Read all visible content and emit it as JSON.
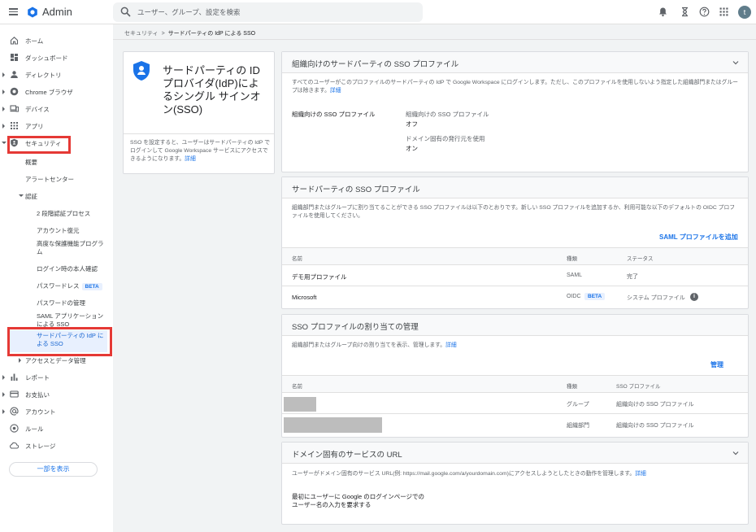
{
  "header": {
    "app_title": "Admin",
    "search_placeholder": "ユーザー、グループ、設定を検索",
    "avatar_letter": "t",
    "colors": {
      "logo": "#1a73e8",
      "accent": "#1a73e8",
      "highlight": "#e53935"
    },
    "icons": [
      "menu-icon",
      "admin-logo-icon",
      "search-icon",
      "notifications-icon",
      "hourglass-icon",
      "help-icon",
      "apps-grid-icon"
    ]
  },
  "sidebar": {
    "items": [
      {
        "label": "ホーム",
        "icon": "home-icon"
      },
      {
        "label": "ダッシュボード",
        "icon": "dashboard-icon"
      },
      {
        "label": "ディレクトリ",
        "icon": "person-icon"
      },
      {
        "label": "Chrome ブラウザ",
        "icon": "chrome-icon"
      },
      {
        "label": "デバイス",
        "icon": "devices-icon"
      },
      {
        "label": "アプリ",
        "icon": "apps-icon"
      },
      {
        "label": "セキュリティ",
        "icon": "shield-icon"
      }
    ],
    "security_sub": {
      "overview": "概要",
      "alert_center": "アラートセンター",
      "auth": "認証",
      "two_step": "2 段階認証プロセス",
      "account_recovery": "アカウント復元",
      "advanced_protection": "高度な保護機能プログラム",
      "login_challenge": "ログイン時の本人確認",
      "passwordless": "パスワードレス",
      "beta": "BETA",
      "password_mgmt": "パスワードの管理",
      "saml_apps": "SAML アプリケーションによる SSO",
      "third_party_sso": "サードパーティの IdP による SSO",
      "access_data": "アクセスとデータ管理"
    },
    "bottom_items": [
      {
        "label": "レポート",
        "icon": "bar-chart-icon"
      },
      {
        "label": "お支払い",
        "icon": "credit-card-icon"
      },
      {
        "label": "アカウント",
        "icon": "at-icon"
      },
      {
        "label": "ルール",
        "icon": "rules-icon"
      },
      {
        "label": "ストレージ",
        "icon": "cloud-icon"
      }
    ],
    "show_less": "一部を表示"
  },
  "breadcrumb": {
    "parent": "セキュリティ",
    "separator": ">",
    "current": "サードパーティの IdP による SSO"
  },
  "info_card": {
    "title": "サードパーティの ID プロバイダ(IdP)によるシングル サインオン(SSO)",
    "description": "SSO を設定すると、ユーザーはサードパーティの IdP でログインして Google Workspace サービスにアクセスできるようになります。",
    "link": "詳細"
  },
  "org_profile": {
    "title": "組織向けのサードパーティの SSO プロファイル",
    "description": "すべてのユーザーがこのプロファイルのサードパーティの IdP で Google Workspace にログインします。ただし、このプロファイルを使用しないよう指定した組織部門またはグループは除きます。",
    "link": "詳細",
    "label": "組織向けの SSO プロファイル",
    "setting1_label": "組織向けの SSO プロファイル",
    "setting1_value": "オフ",
    "setting2_label": "ドメイン固有の発行元を使用",
    "setting2_value": "オン"
  },
  "third_party_profiles": {
    "title": "サードパーティの SSO プロファイル",
    "description": "組織部門またはグループに割り当てることができる SSO プロファイルは以下のとおりです。新しい SSO プロファイルを追加するか、利用可能な以下のデフォルトの OIDC プロファイルを使用してください。",
    "add_button": "SAML プロファイルを追加",
    "columns": [
      "名前",
      "種類",
      "ステータス"
    ],
    "rows": [
      {
        "name": "デモ用プロファイル",
        "type": "SAML",
        "status": "完了",
        "beta": ""
      },
      {
        "name": "Microsoft",
        "type": "OIDC",
        "status": "システム プロファイル",
        "beta": "BETA"
      }
    ],
    "info_glyph": "i"
  },
  "assignment": {
    "title": "SSO プロファイルの割り当ての管理",
    "description": "組織部門またはグループ向けの割り当てを表示、管理します。",
    "link": "詳細",
    "manage_button": "管理",
    "columns": [
      "名前",
      "種類",
      "SSO プロファイル"
    ],
    "rows": [
      {
        "type": "グループ",
        "profile": "組織向けの SSO プロファイル"
      },
      {
        "type": "組織部門",
        "profile": "組織向けの SSO プロファイル"
      }
    ]
  },
  "domain_url": {
    "title": "ドメイン固有のサービスの URL",
    "description": "ユーザーがドメイン固有のサービス URL(例: https://mail.google.com/a/yourdomain.com)にアクセスしようとしたときの動作を管理します。",
    "link": "詳細",
    "setting_line1": "最初にユーザーに Google のログインページでの",
    "setting_line2": "ユーザー名の入力を要求する"
  }
}
